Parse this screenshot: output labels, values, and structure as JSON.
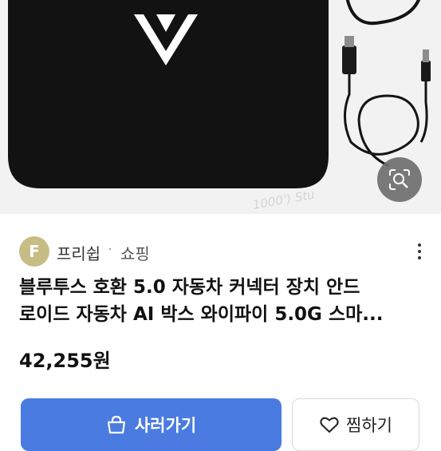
{
  "product_image": {
    "watermark": "1000’) Stu"
  },
  "seller": {
    "avatar_letter": "F",
    "name": "프리쉽",
    "separator": "·",
    "category": "쇼핑"
  },
  "product": {
    "title_line1": "블루투스 호환 5.0 자동차 커넥터 장치 안드",
    "title_line2": "로이드 자동차 AI 박스 와이파이 5.0G 스마...",
    "price": "42,255원"
  },
  "actions": {
    "buy_label": "사러가기",
    "wish_label": "찜하기"
  },
  "icons": {
    "lens": "image-search-icon",
    "more": "more-vertical-icon",
    "bag": "shopping-bag-icon",
    "heart": "heart-icon"
  },
  "colors": {
    "primary": "#4a7be0",
    "avatar": "#c7bd84"
  }
}
